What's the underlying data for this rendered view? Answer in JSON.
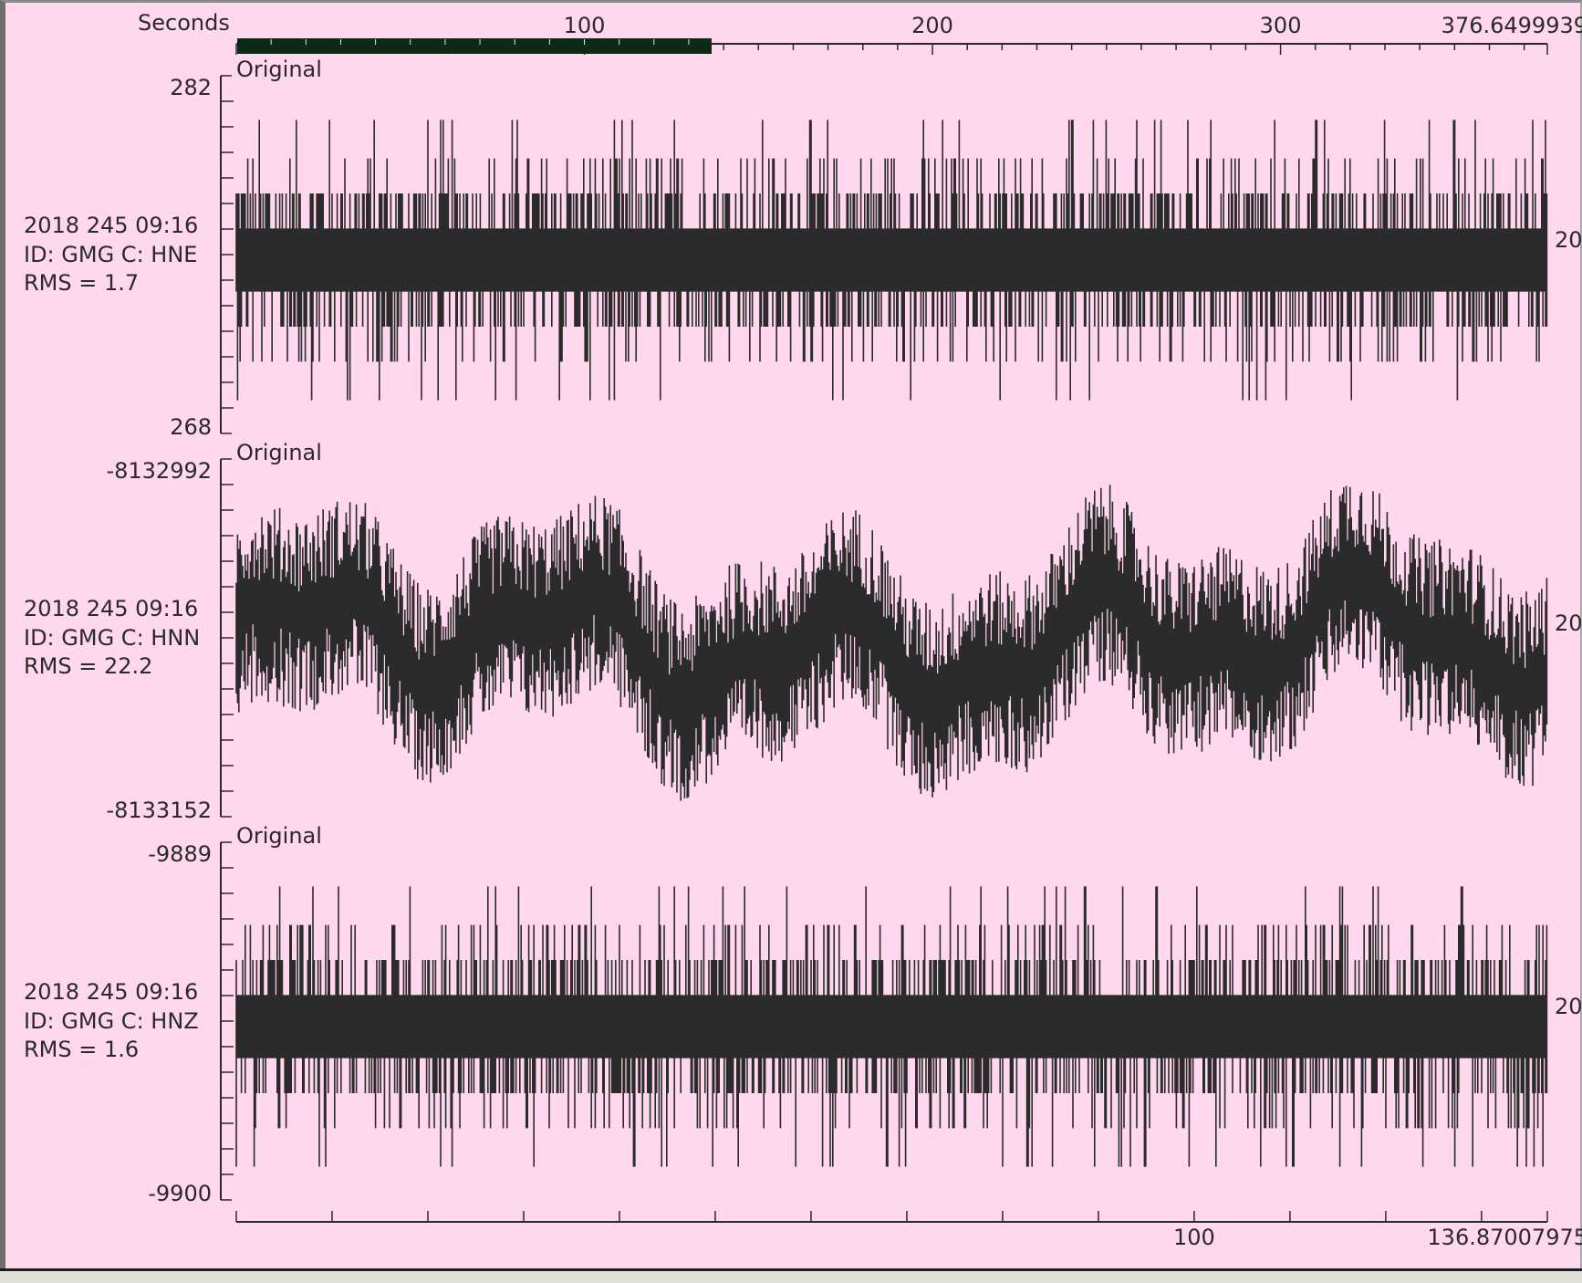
{
  "colors": {
    "background": "#ffd8ef",
    "trace": "#2b2b2b",
    "axis": "#2a2a2a",
    "selection_bar": "#0d2a16"
  },
  "top_axis": {
    "label": "Seconds",
    "ticks": [
      100,
      200,
      300
    ],
    "end_label": "376.6499939",
    "max": 376.6499939
  },
  "bottom_axis": {
    "ticks": [
      100
    ],
    "end_label": "136.87007975",
    "max": 136.87007975
  },
  "traces": [
    {
      "tag": "Original",
      "date": "2018 245 09:16",
      "id": "ID: GMG C: HNE",
      "rms": "RMS = 1.7",
      "ymax": "282",
      "ymin": "268",
      "right_label": "20",
      "style": "quantized"
    },
    {
      "tag": "Original",
      "date": "2018 245 09:16",
      "id": "ID: GMG C: HNN",
      "rms": "RMS = 22.2",
      "ymax": "-8132992",
      "ymin": "-8133152",
      "right_label": "20",
      "style": "wander"
    },
    {
      "tag": "Original",
      "date": "2018 245 09:16",
      "id": "ID: GMG C: HNZ",
      "rms": "RMS = 1.6",
      "ymax": "-9889",
      "ymin": "-9900",
      "right_label": "20",
      "style": "quantized"
    }
  ]
}
